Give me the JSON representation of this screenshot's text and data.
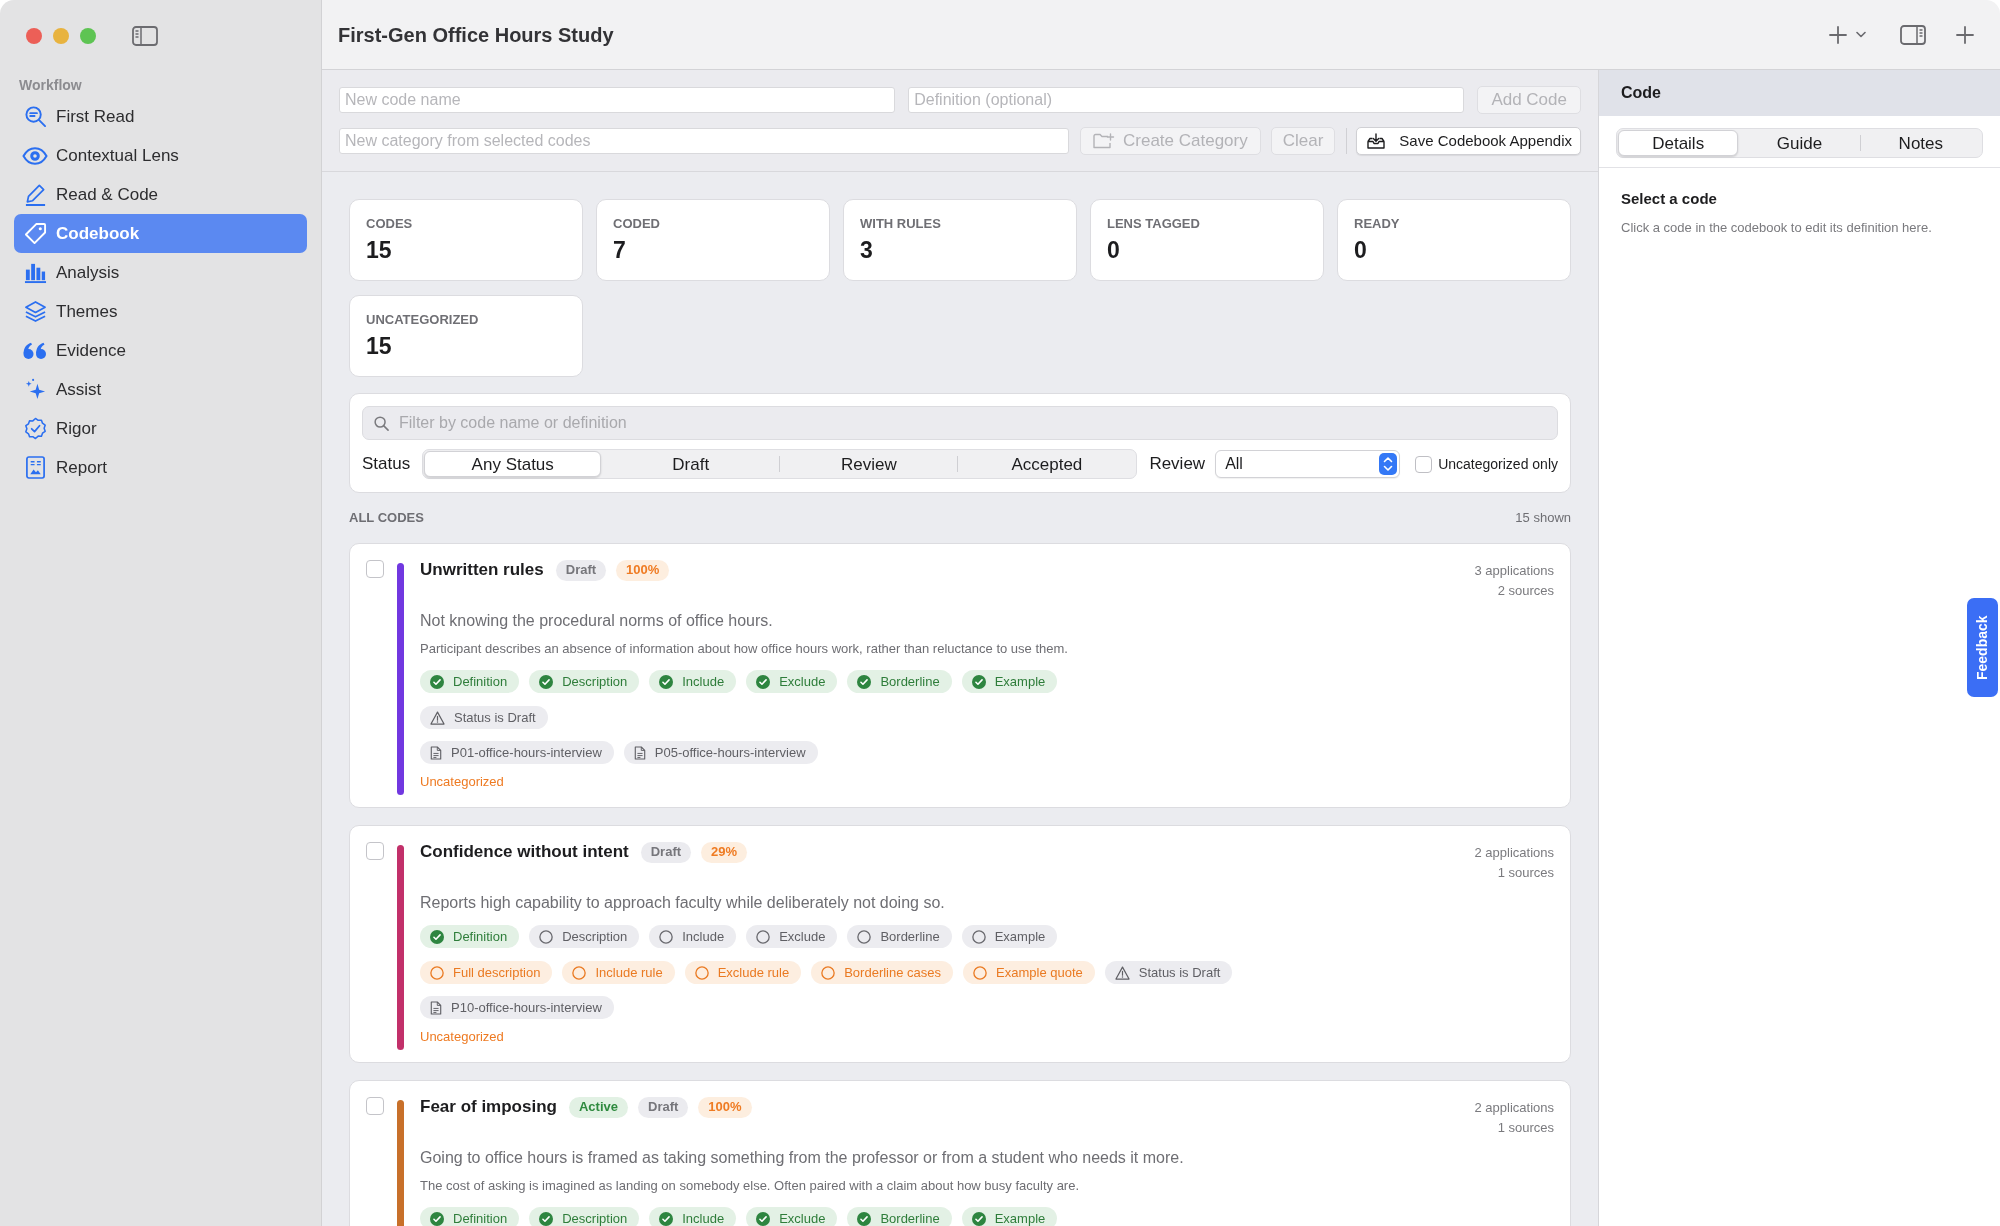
{
  "window": {
    "title": "First-Gen Office Hours Study"
  },
  "sidebar": {
    "section": "Workflow",
    "items": [
      {
        "label": "First Read",
        "selected": false
      },
      {
        "label": "Contextual Lens",
        "selected": false
      },
      {
        "label": "Read & Code",
        "selected": false
      },
      {
        "label": "Codebook",
        "selected": true
      },
      {
        "label": "Analysis",
        "selected": false
      },
      {
        "label": "Themes",
        "selected": false
      },
      {
        "label": "Evidence",
        "selected": false
      },
      {
        "label": "Assist",
        "selected": false
      },
      {
        "label": "Rigor",
        "selected": false
      },
      {
        "label": "Report",
        "selected": false
      }
    ]
  },
  "new_code_form": {
    "name_field": {
      "placeholder": "New code name"
    },
    "definition_field": {
      "placeholder": "Definition (optional)"
    },
    "add_button": {
      "label": "Add Code",
      "disabled": true
    }
  },
  "category_form": {
    "category_field": {
      "placeholder": "New category from selected codes"
    },
    "create_button": {
      "label": "Create Category",
      "disabled": true
    },
    "clear_button": {
      "label": "Clear",
      "disabled": true
    },
    "save_button": {
      "label": "Save Codebook Appendix",
      "disabled": false
    }
  },
  "stats": [
    {
      "label": "CODES",
      "value": "15"
    },
    {
      "label": "CODED",
      "value": "7"
    },
    {
      "label": "WITH RULES",
      "value": "3"
    },
    {
      "label": "LENS TAGGED",
      "value": "0"
    },
    {
      "label": "READY",
      "value": "0"
    },
    {
      "label": "UNCATEGORIZED",
      "value": "15"
    }
  ],
  "filter": {
    "search": {
      "placeholder": "Filter by code name or definition"
    },
    "status_label": "Status",
    "status_options": [
      {
        "label": "Any Status",
        "selected": true
      },
      {
        "label": "Draft",
        "selected": false
      },
      {
        "label": "Review",
        "selected": false
      },
      {
        "label": "Accepted",
        "selected": false
      }
    ],
    "review_label": "Review",
    "review_select": {
      "value": "All"
    },
    "uncategorized_only": {
      "label": "Uncategorized only",
      "checked": false
    }
  },
  "list_header": {
    "title": "ALL CODES",
    "count": "15 shown"
  },
  "codes": [
    {
      "name": "Unwritten rules",
      "checked": false,
      "color": "#7138e0",
      "badges": [
        {
          "label": "Draft",
          "kind": "draft"
        },
        {
          "label": "100%",
          "kind": "completion"
        }
      ],
      "applications": "3 applications",
      "sources_count": "2 sources",
      "definition": "Not knowing the procedural norms of office hours.",
      "description": "Participant describes an absence of information about how office hours work, rather than reluctance to use them.",
      "checks": [
        {
          "label": "Definition",
          "done": true
        },
        {
          "label": "Description",
          "done": true
        },
        {
          "label": "Include",
          "done": true
        },
        {
          "label": "Exclude",
          "done": true
        },
        {
          "label": "Borderline",
          "done": true
        },
        {
          "label": "Example",
          "done": true
        }
      ],
      "issues": [
        {
          "label": "Status is Draft",
          "kind": "warning"
        }
      ],
      "sources": [
        "P01-office-hours-interview",
        "P05-office-hours-interview"
      ],
      "category": "Uncategorized"
    },
    {
      "name": "Confidence without intent",
      "checked": false,
      "color": "#c2306a",
      "badges": [
        {
          "label": "Draft",
          "kind": "draft"
        },
        {
          "label": "29%",
          "kind": "completion"
        }
      ],
      "applications": "2 applications",
      "sources_count": "1 sources",
      "definition": "Reports high capability to approach faculty while deliberately not doing so.",
      "checks": [
        {
          "label": "Definition",
          "done": true
        },
        {
          "label": "Description",
          "done": false
        },
        {
          "label": "Include",
          "done": false
        },
        {
          "label": "Exclude",
          "done": false
        },
        {
          "label": "Borderline",
          "done": false
        },
        {
          "label": "Example",
          "done": false
        }
      ],
      "issues": [
        {
          "label": "Full description",
          "kind": "missing"
        },
        {
          "label": "Include rule",
          "kind": "missing"
        },
        {
          "label": "Exclude rule",
          "kind": "missing"
        },
        {
          "label": "Borderline cases",
          "kind": "missing"
        },
        {
          "label": "Example quote",
          "kind": "missing"
        },
        {
          "label": "Status is Draft",
          "kind": "warning"
        }
      ],
      "sources": [
        "P10-office-hours-interview"
      ],
      "category": "Uncategorized"
    },
    {
      "name": "Fear of imposing",
      "checked": false,
      "color": "#c8702a",
      "badges": [
        {
          "label": "Active",
          "kind": "active"
        },
        {
          "label": "Draft",
          "kind": "draft"
        },
        {
          "label": "100%",
          "kind": "completion"
        }
      ],
      "applications": "2 applications",
      "sources_count": "1 sources",
      "definition": "Going to office hours is framed as taking something from the professor or from a student who needs it more.",
      "description": "The cost of asking is imagined as landing on somebody else. Often paired with a claim about how busy faculty are.",
      "checks": [
        {
          "label": "Definition",
          "done": true
        },
        {
          "label": "Description",
          "done": true
        },
        {
          "label": "Include",
          "done": true
        },
        {
          "label": "Exclude",
          "done": true
        },
        {
          "label": "Borderline",
          "done": true
        },
        {
          "label": "Example",
          "done": true
        }
      ]
    }
  ],
  "detail_panel": {
    "title": "Code",
    "tabs": [
      {
        "label": "Details",
        "selected": true
      },
      {
        "label": "Guide",
        "selected": false
      },
      {
        "label": "Notes",
        "selected": false
      }
    ],
    "empty_title": "Select a code",
    "empty_text": "Click a code in the codebook to edit its definition here."
  },
  "feedback_button": {
    "label": "Feedback"
  }
}
